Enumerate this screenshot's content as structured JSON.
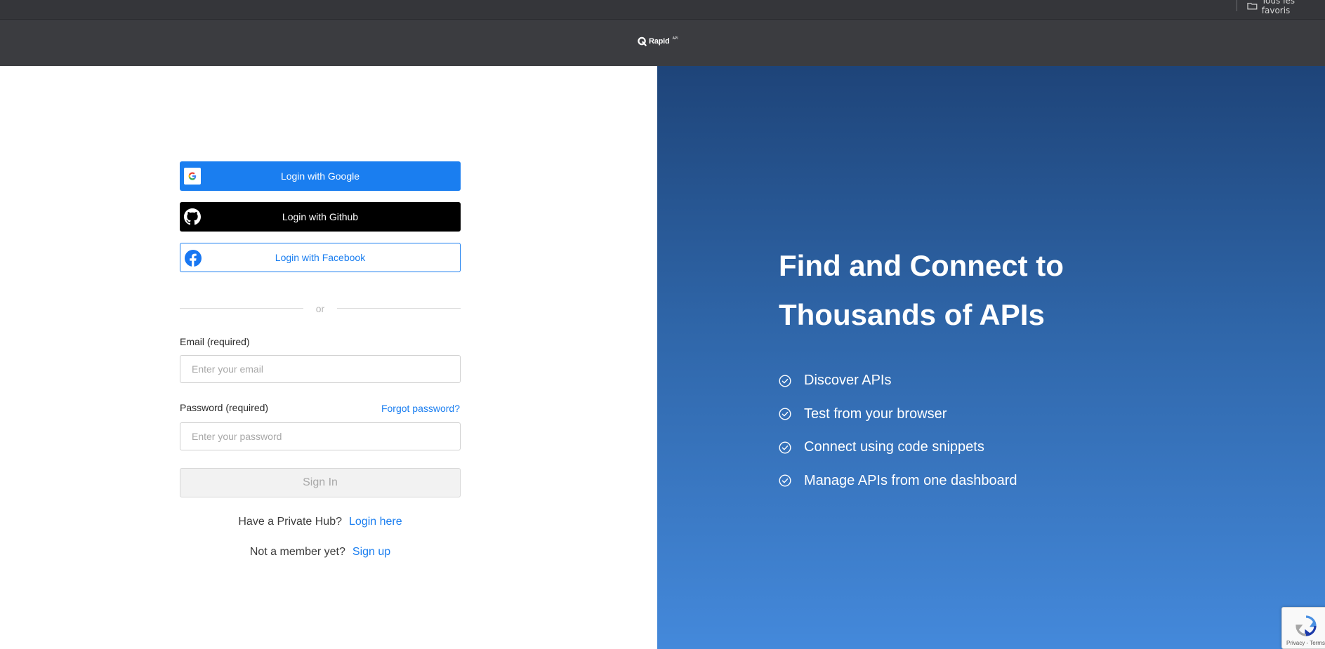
{
  "browser": {
    "bookmark_folder": "Tous les favoris"
  },
  "header": {
    "logo_text": "Rapid",
    "logo_sup": "API"
  },
  "login": {
    "google_label": "Login with Google",
    "github_label": "Login with Github",
    "facebook_label": "Login with Facebook",
    "divider_text": "or",
    "email_label": "Email (required)",
    "email_placeholder": "Enter your email",
    "email_value": "",
    "password_label": "Password (required)",
    "password_placeholder": "Enter your password",
    "password_value": "",
    "forgot_password": "Forgot password?",
    "signin_label": "Sign In",
    "private_hub_text": "Have a Private Hub?",
    "private_hub_link": "Login here",
    "member_text": "Not a member yet?",
    "member_link": "Sign up"
  },
  "promo": {
    "title_line1": "Find and Connect to",
    "title_line2": "Thousands of APIs",
    "features": [
      {
        "label": "Discover APIs",
        "icon": "check-circle-icon"
      },
      {
        "label": "Test from your browser",
        "icon": "check-circle-icon"
      },
      {
        "label": "Connect using code snippets",
        "icon": "check-circle-icon"
      },
      {
        "label": "Manage APIs from one dashboard",
        "icon": "check-circle-icon"
      }
    ]
  },
  "recaptcha": {
    "links": "Privacy - Terms"
  },
  "colors": {
    "accent": "#1a7ef0",
    "header_bg": "#3b3c40",
    "gradient_top": "#1e4479",
    "gradient_bottom": "#4489db"
  }
}
